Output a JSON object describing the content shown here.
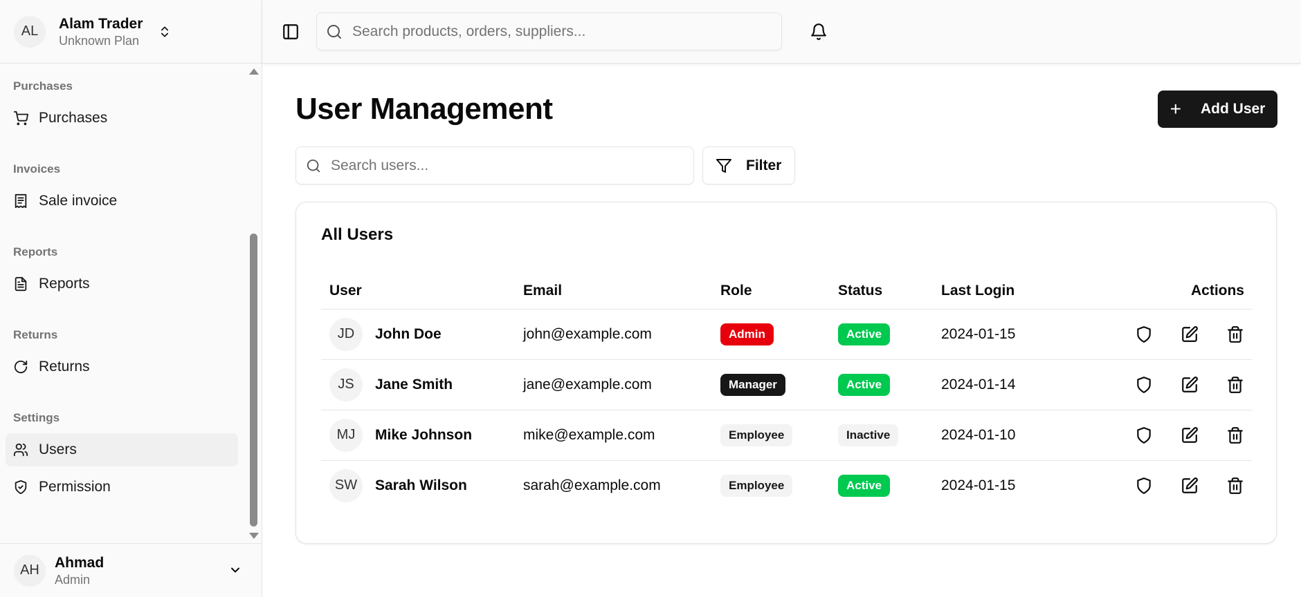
{
  "org": {
    "initials": "AL",
    "name": "Alam Trader",
    "plan": "Unknown Plan"
  },
  "sidebar": {
    "groups": [
      {
        "label": "Purchases",
        "item": {
          "label": "Purchases",
          "icon": "cart-icon"
        }
      },
      {
        "label": "Invoices",
        "item": {
          "label": "Sale invoice",
          "icon": "receipt-icon"
        }
      },
      {
        "label": "Reports",
        "item": {
          "label": "Reports",
          "icon": "file-text-icon"
        }
      },
      {
        "label": "Returns",
        "item": {
          "label": "Returns",
          "icon": "rotate-icon"
        }
      },
      {
        "label": "Settings",
        "items": [
          {
            "label": "Users",
            "icon": "users-icon",
            "active": true
          },
          {
            "label": "Permission",
            "icon": "shield-check-icon"
          }
        ]
      }
    ]
  },
  "current_user": {
    "initials": "AH",
    "name": "Ahmad",
    "role": "Admin"
  },
  "topbar": {
    "search_placeholder": "Search products, orders, suppliers..."
  },
  "page": {
    "title": "User Management",
    "add_button": "Add User",
    "search_placeholder": "Search users...",
    "filter_label": "Filter"
  },
  "table": {
    "title": "All Users",
    "columns": [
      "User",
      "Email",
      "Role",
      "Status",
      "Last Login",
      "Actions"
    ],
    "rows": [
      {
        "initials": "JD",
        "name": "John Doe",
        "email": "john@example.com",
        "role": "Admin",
        "status": "Active",
        "last_login": "2024-01-15"
      },
      {
        "initials": "JS",
        "name": "Jane Smith",
        "email": "jane@example.com",
        "role": "Manager",
        "status": "Active",
        "last_login": "2024-01-14"
      },
      {
        "initials": "MJ",
        "name": "Mike Johnson",
        "email": "mike@example.com",
        "role": "Employee",
        "status": "Inactive",
        "last_login": "2024-01-10"
      },
      {
        "initials": "SW",
        "name": "Sarah Wilson",
        "email": "sarah@example.com",
        "role": "Employee",
        "status": "Active",
        "last_login": "2024-01-15"
      }
    ]
  },
  "colors": {
    "admin_badge": "#e7000b",
    "manager_badge": "#171717",
    "active_badge": "#00c950",
    "primary_button": "#171717"
  }
}
